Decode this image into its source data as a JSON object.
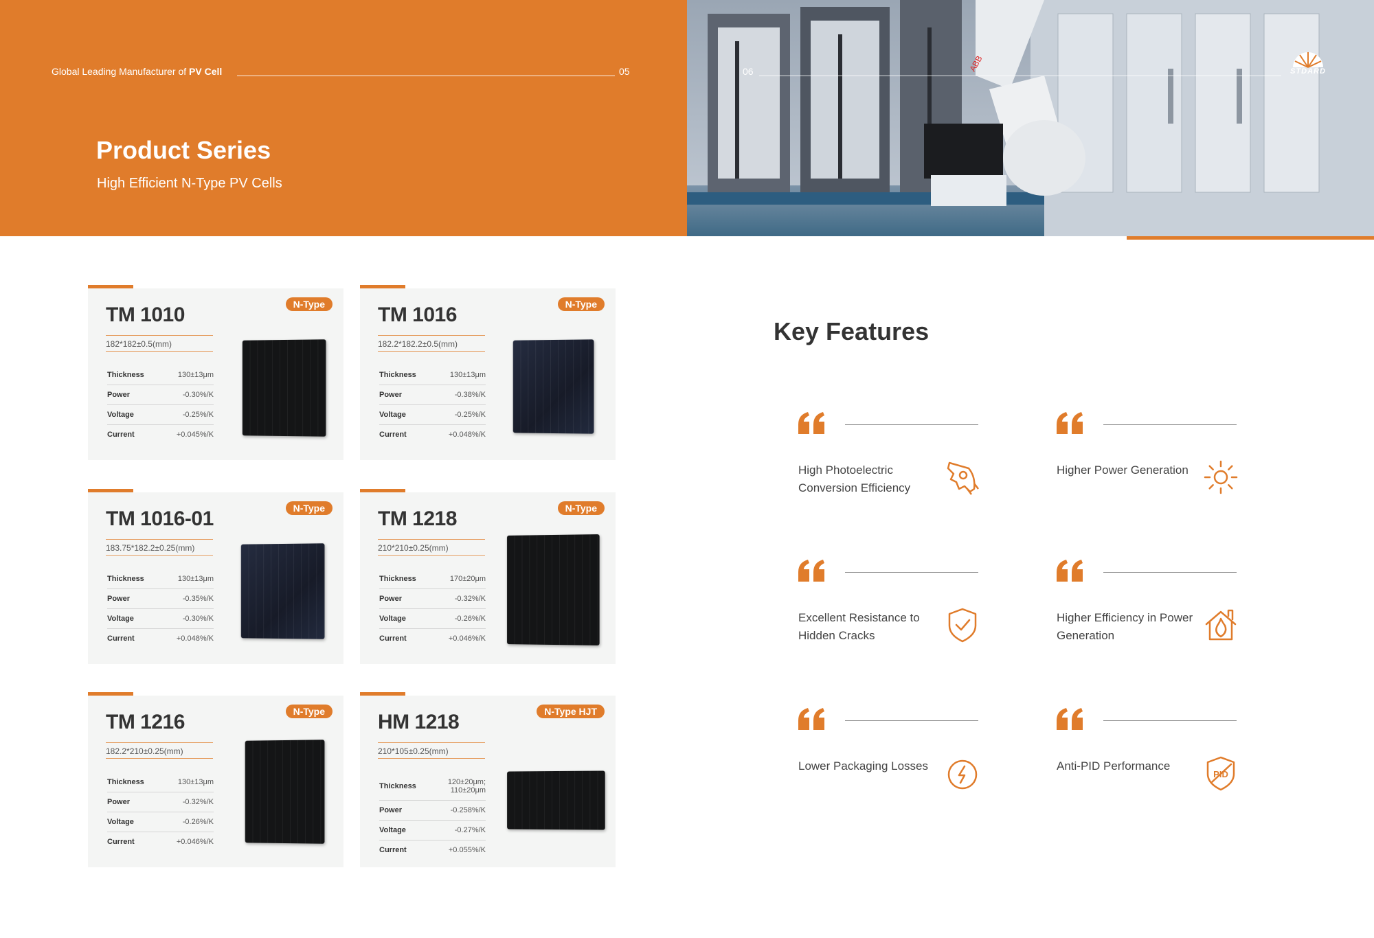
{
  "header": {
    "tagline_prefix": "Global Leading Manufacturer of",
    "tagline_bold": "PV Cell",
    "page_left": "05",
    "page_right": "06",
    "title": "Product Series",
    "subtitle": "High Efficient N-Type PV Cells",
    "logo_text": "STDARD"
  },
  "colors": {
    "accent": "#e07c2b",
    "card_bg": "#f4f5f4",
    "text": "#333333"
  },
  "products": [
    {
      "name": "TM 1010",
      "badge": "N-Type",
      "dims": "182*182±0.5(mm)",
      "specs": [
        {
          "k": "Thickness",
          "v": "130±13μm"
        },
        {
          "k": "Power",
          "v": "-0.30%/K"
        },
        {
          "k": "Voltage",
          "v": "-0.25%/K"
        },
        {
          "k": "Current",
          "v": "+0.045%/K"
        }
      ]
    },
    {
      "name": "TM 1016",
      "badge": "N-Type",
      "dims": "182.2*182.2±0.5(mm)",
      "specs": [
        {
          "k": "Thickness",
          "v": "130±13μm"
        },
        {
          "k": "Power",
          "v": "-0.38%/K"
        },
        {
          "k": "Voltage",
          "v": "-0.25%/K"
        },
        {
          "k": "Current",
          "v": "+0.048%/K"
        }
      ]
    },
    {
      "name": "TM 1016-01",
      "badge": "N-Type",
      "dims": "183.75*182.2±0.25(mm)",
      "specs": [
        {
          "k": "Thickness",
          "v": "130±13μm"
        },
        {
          "k": "Power",
          "v": "-0.35%/K"
        },
        {
          "k": "Voltage",
          "v": "-0.30%/K"
        },
        {
          "k": "Current",
          "v": "+0.048%/K"
        }
      ]
    },
    {
      "name": "TM 1218",
      "badge": "N-Type",
      "dims": "210*210±0.25(mm)",
      "specs": [
        {
          "k": "Thickness",
          "v": "170±20μm"
        },
        {
          "k": "Power",
          "v": "-0.32%/K"
        },
        {
          "k": "Voltage",
          "v": "-0.26%/K"
        },
        {
          "k": "Current",
          "v": "+0.046%/K"
        }
      ]
    },
    {
      "name": "TM 1216",
      "badge": "N-Type",
      "dims": "182.2*210±0.25(mm)",
      "specs": [
        {
          "k": "Thickness",
          "v": "130±13μm"
        },
        {
          "k": "Power",
          "v": "-0.32%/K"
        },
        {
          "k": "Voltage",
          "v": "-0.26%/K"
        },
        {
          "k": "Current",
          "v": "+0.046%/K"
        }
      ]
    },
    {
      "name": "HM 1218",
      "badge": "N-Type HJT",
      "dims": "210*105±0.25(mm)",
      "specs": [
        {
          "k": "Thickness",
          "v": "120±20μm;\n110±20μm"
        },
        {
          "k": "Power",
          "v": "-0.258%/K"
        },
        {
          "k": "Voltage",
          "v": "-0.27%/K"
        },
        {
          "k": "Current",
          "v": "+0.055%/K"
        }
      ]
    }
  ],
  "key_features": {
    "title": "Key Features",
    "items": [
      {
        "text": "High Photoelectric Conversion Efficiency",
        "icon": "rocket-icon"
      },
      {
        "text": "Higher Power Generation",
        "icon": "sun-icon"
      },
      {
        "text": "Excellent Resistance to Hidden Cracks",
        "icon": "shield-check-icon"
      },
      {
        "text": "Higher Efficiency in Power Generation",
        "icon": "house-leaf-icon"
      },
      {
        "text": "Lower Packaging Losses",
        "icon": "lightning-icon"
      },
      {
        "text": "Anti-PID Performance",
        "icon": "anti-pid-shield-icon"
      }
    ]
  }
}
